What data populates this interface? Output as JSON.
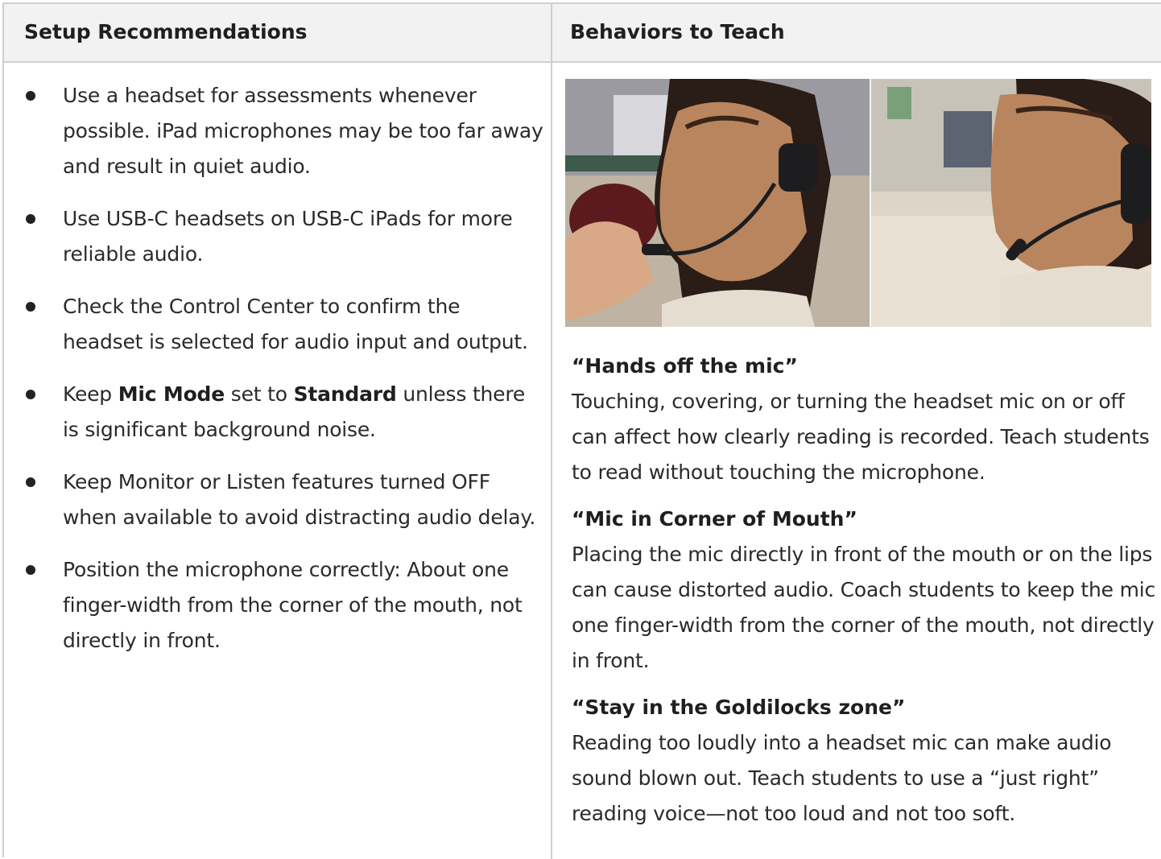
{
  "headers": {
    "left": "Setup Recommendations",
    "right": "Behaviors to Teach"
  },
  "setup": [
    {
      "text": "Use a headset for assessments whenever possible. iPad microphones may be too far away and result in quiet audio."
    },
    {
      "text": "Use USB-C headsets on USB-C iPads for more reliable audio."
    },
    {
      "text": "Check the Control Center to confirm the headset is selected for audio input and output."
    },
    {
      "pre": "Keep ",
      "bold1": "Mic Mode",
      "mid": " set to ",
      "bold2": "Standard",
      "post": " unless there is significant background noise."
    },
    {
      "text": "Keep Monitor or Listen features turned OFF when available to avoid distracting audio delay."
    },
    {
      "text": "Position the microphone correctly: About one finger-width from the corner of the mouth, not directly in front."
    }
  ],
  "behaviors": [
    {
      "title": "“Hands off the mic”",
      "body": "Touching, covering, or turning the headset mic on or off can affect how clearly reading is recorded. Teach students to read without touching the microphone."
    },
    {
      "title": "“Mic in Corner of Mouth”",
      "body": "Placing the mic directly in front of the mouth or on the lips can cause distorted audio. Coach students to keep the mic one finger-width from the corner of the mouth, not directly in front."
    },
    {
      "title": "“Stay in the Goldilocks zone”",
      "body": "Reading too loudly into a headset mic can make audio sound blown out. Teach students to use a “just right” reading voice—not too loud and not too soft."
    }
  ],
  "colors": {
    "header_bg": "#f2f2f2",
    "border": "#cfcfcf",
    "text": "#2a2a2a"
  }
}
